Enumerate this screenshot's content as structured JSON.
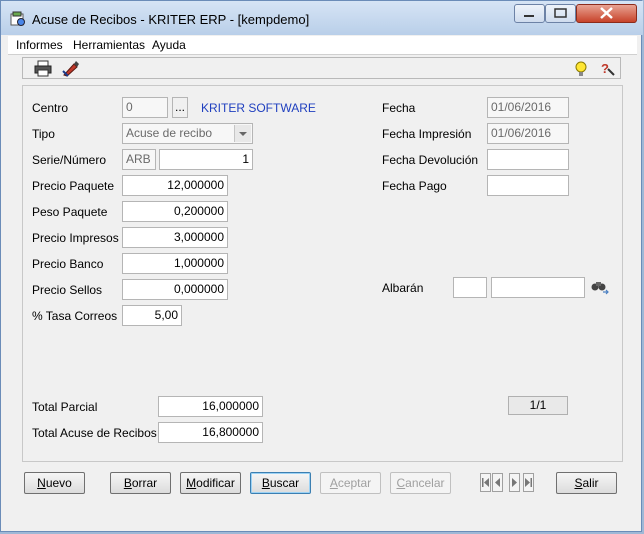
{
  "window": {
    "title": "Acuse de Recibos - KRITER ERP - [kempdemo]"
  },
  "menu": [
    {
      "label": "Informes"
    },
    {
      "label": "Herramientas"
    },
    {
      "label": "Ayuda"
    }
  ],
  "toolbar": {
    "icons": [
      "printer-icon",
      "edit-pen-icon",
      "lightbulb-icon",
      "help-icon"
    ]
  },
  "form": {
    "centro": {
      "label": "Centro",
      "value": "0",
      "button": "...",
      "name": "KRITER SOFTWARE"
    },
    "tipo": {
      "label": "Tipo",
      "value": "Acuse de recibo"
    },
    "serie_numero": {
      "label": "Serie/Número",
      "serie": "ARB",
      "numero": "1"
    },
    "precio_paquete": {
      "label": "Precio Paquete",
      "value": "12,000000"
    },
    "peso_paquete": {
      "label": "Peso Paquete",
      "value": "0,200000"
    },
    "precio_impresos": {
      "label": "Precio Impresos",
      "value": "3,000000"
    },
    "precio_banco": {
      "label": "Precio Banco",
      "value": "1,000000"
    },
    "precio_sellos": {
      "label": "Precio Sellos",
      "value": "0,000000"
    },
    "tasa_correos": {
      "label": "% Tasa Correos",
      "value": "5,00"
    },
    "fecha": {
      "label": "Fecha",
      "value": "01/06/2016"
    },
    "fecha_impresion": {
      "label": "Fecha Impresión",
      "value": "01/06/2016"
    },
    "fecha_devolucion": {
      "label": "Fecha Devolución",
      "value": ""
    },
    "fecha_pago": {
      "label": "Fecha Pago",
      "value": ""
    },
    "albaran": {
      "label": "Albarán",
      "value1": "",
      "value2": ""
    },
    "total_parcial": {
      "label": "Total Parcial",
      "value": "16,000000"
    },
    "total_acuse": {
      "label": "Total Acuse de Recibos",
      "value": "16,800000"
    },
    "record_counter": "1/1"
  },
  "buttons": {
    "nuevo": {
      "first": "N",
      "rest": "uevo"
    },
    "borrar": {
      "first": "B",
      "rest": "orrar"
    },
    "modificar": {
      "first": "M",
      "rest": "odificar"
    },
    "buscar": {
      "first": "B",
      "rest": "uscar"
    },
    "aceptar": {
      "first": "A",
      "rest": "ceptar"
    },
    "cancelar": {
      "first": "C",
      "rest": "ancelar"
    },
    "salir": {
      "first": "S",
      "rest": "alir"
    }
  },
  "colors": {
    "accent_link": "#1f3fbf",
    "titlebar": "#c6d8ee"
  }
}
